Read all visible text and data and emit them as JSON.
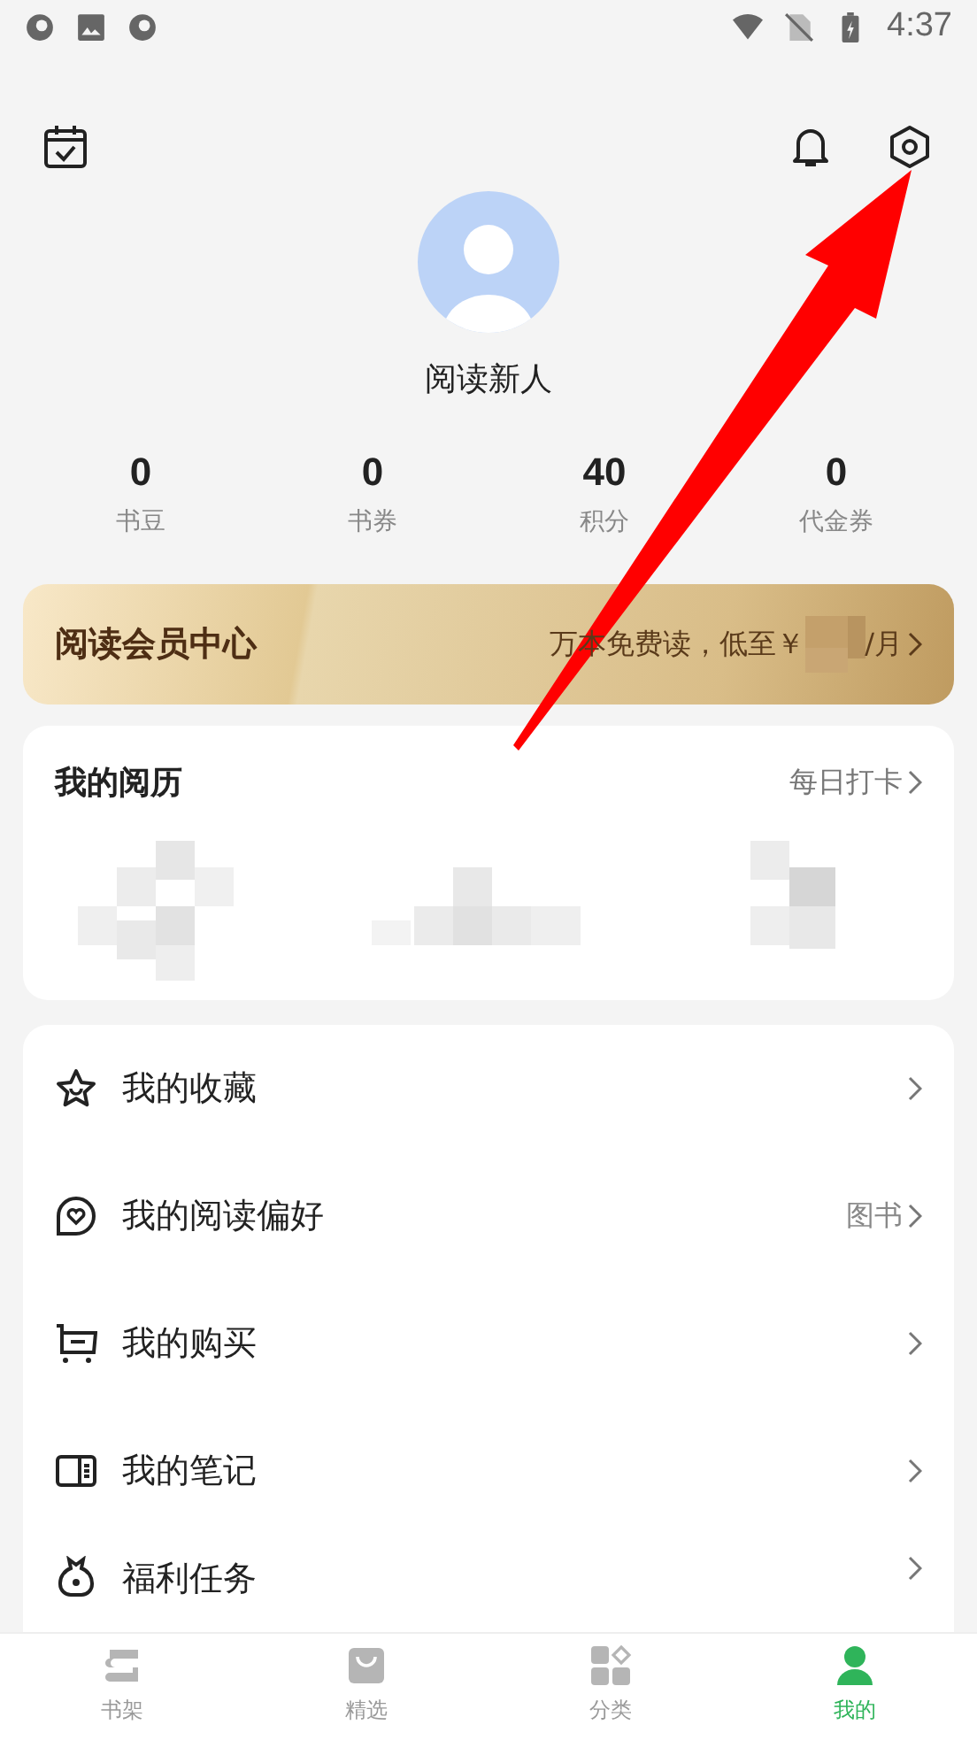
{
  "status_bar": {
    "time": "4:37"
  },
  "profile": {
    "name": "阅读新人"
  },
  "stats": [
    {
      "value": "0",
      "label": "书豆"
    },
    {
      "value": "0",
      "label": "书券"
    },
    {
      "value": "40",
      "label": "积分"
    },
    {
      "value": "0",
      "label": "代金券"
    }
  ],
  "vip_banner": {
    "title": "阅读会员中心",
    "offer": "万本免费读，低至￥",
    "unit": "/月"
  },
  "history": {
    "title": "我的阅历",
    "action": "每日打卡"
  },
  "menu": [
    {
      "kind": "star",
      "label": "我的收藏"
    },
    {
      "kind": "heart",
      "label": "我的阅读偏好",
      "value": "图书"
    },
    {
      "kind": "cart",
      "label": "我的购买"
    },
    {
      "kind": "notes",
      "label": "我的笔记"
    },
    {
      "kind": "bag",
      "label": "福利任务"
    }
  ],
  "tab_bar": [
    {
      "kind": "shelf",
      "label": "书架",
      "selected": false
    },
    {
      "kind": "picks",
      "label": "精选",
      "selected": false
    },
    {
      "kind": "category",
      "label": "分类",
      "selected": false
    },
    {
      "kind": "me",
      "label": "我的",
      "selected": true
    }
  ]
}
